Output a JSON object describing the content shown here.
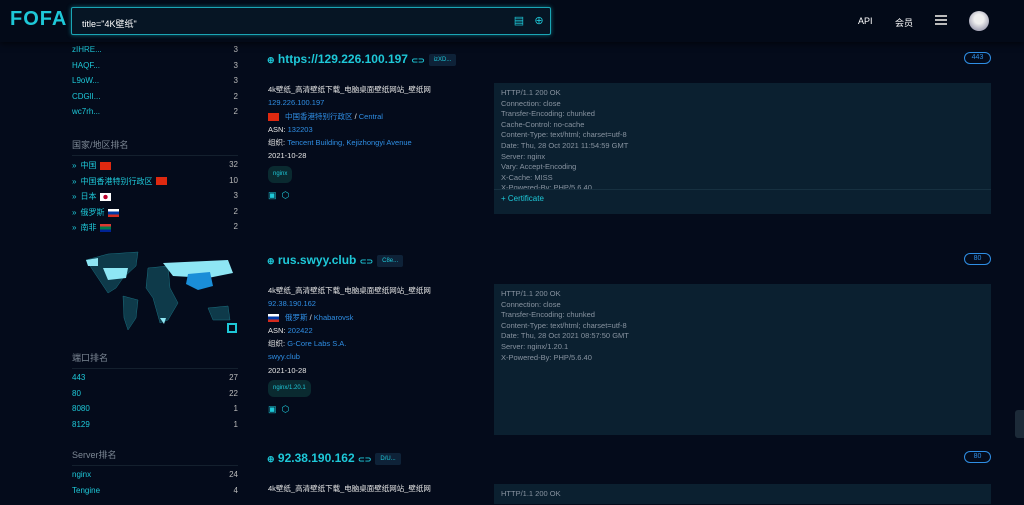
{
  "header": {
    "logo": "FOFA",
    "query": "title=\"4K壁纸\"",
    "nav": [
      "API",
      "会员"
    ]
  },
  "sidebar": {
    "top_items": [
      {
        "label": "zIHRE...",
        "count": "3"
      },
      {
        "label": "HAQF...",
        "count": "3"
      },
      {
        "label": "L9oW...",
        "count": "3"
      },
      {
        "label": "CDGlI...",
        "count": "2"
      },
      {
        "label": "wc7rh...",
        "count": "2"
      }
    ],
    "country_title": "国家/地区排名",
    "countries": [
      {
        "label": "中国",
        "count": "32",
        "flag": "cn"
      },
      {
        "label": "中国香港特别行政区",
        "count": "10",
        "flag": "hk"
      },
      {
        "label": "日本",
        "count": "3",
        "flag": "jp"
      },
      {
        "label": "俄罗斯",
        "count": "2",
        "flag": "ru"
      },
      {
        "label": "南非",
        "count": "2",
        "flag": "za"
      }
    ],
    "port_title": "端口排名",
    "ports": [
      {
        "label": "443",
        "count": "27"
      },
      {
        "label": "80",
        "count": "22"
      },
      {
        "label": "8080",
        "count": "1"
      },
      {
        "label": "8129",
        "count": "1"
      }
    ],
    "server_title": "Server排名",
    "servers": [
      {
        "label": "nginx",
        "count": "24"
      },
      {
        "label": "Tengine",
        "count": "4"
      }
    ]
  },
  "results": [
    {
      "host": "https://129.226.100.197",
      "tag": "izXD...",
      "port": "443",
      "title": "4k壁纸_高清壁纸下载_电脑桌面壁纸网站_壁纸网",
      "ip": "129.226.100.197",
      "country": "中国香港特别行政区",
      "city": "Central",
      "asn_label": "ASN:",
      "asn": "132203",
      "org_label": "组织:",
      "org": "Tencent Building, Kejizhongyi Avenue",
      "domain": "",
      "date": "2021-10-28",
      "server": "nginx",
      "cert": "Certificate",
      "headers": "HTTP/1.1 200 OK\nConnection: close\nTransfer-Encoding: chunked\nCache-Control: no-cache\nContent-Type: text/html; charset=utf-8\nDate: Thu, 28 Oct 2021 11:54:59 GMT\nServer: nginx\nVary: Accept-Encoding\nX-Cache: MISS\nX-Powered-By: PHP/5.6.40"
    },
    {
      "host": "rus.swyy.club",
      "tag": "C8e...",
      "port": "80",
      "title": "4k壁纸_高清壁纸下载_电脑桌面壁纸网站_壁纸网",
      "ip": "92.38.190.162",
      "country": "俄罗斯",
      "city": "Khabarovsk",
      "asn_label": "ASN:",
      "asn": "202422",
      "org_label": "组织:",
      "org": "G-Core Labs S.A.",
      "domain": "swyy.club",
      "date": "2021-10-28",
      "server": "nginx/1.20.1",
      "headers": "HTTP/1.1 200 OK\nConnection: close\nTransfer-Encoding: chunked\nContent-Type: text/html; charset=utf-8\nDate: Thu, 28 Oct 2021 08:57:50 GMT\nServer: nginx/1.20.1\nX-Powered-By: PHP/5.6.40"
    },
    {
      "host": "92.38.190.162",
      "tag": "D/U...",
      "port": "80",
      "title": "4k壁纸_高清壁纸下载_电脑桌面壁纸网站_壁纸网",
      "headers": "HTTP/1.1 200 OK"
    }
  ]
}
